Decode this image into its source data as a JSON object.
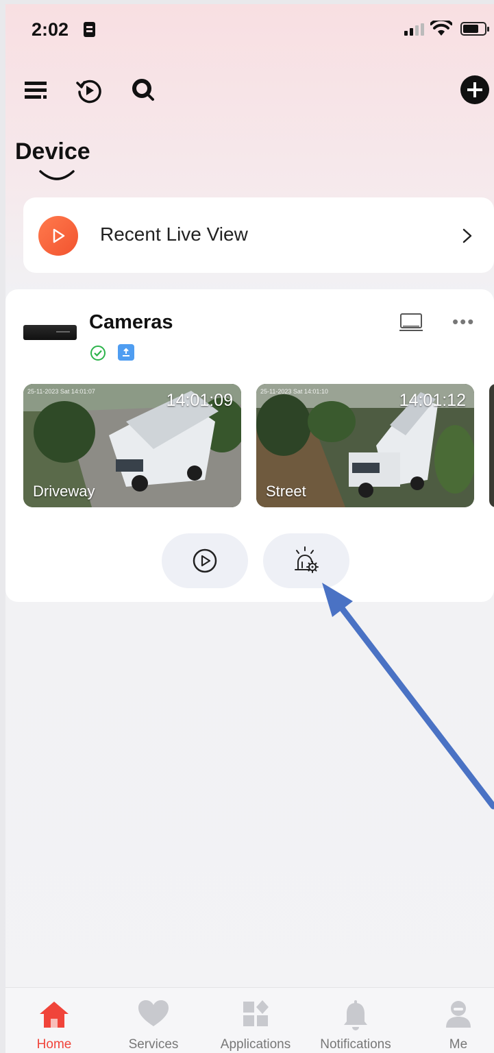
{
  "status_bar": {
    "time": "2:02"
  },
  "header": {
    "title": "Device"
  },
  "recent_live_view": {
    "label": "Recent Live View"
  },
  "cameras_card": {
    "title": "Cameras",
    "more": "•••",
    "cameras": [
      {
        "name": "Driveway",
        "clock": "14:01:09",
        "stamp": "25-11-2023 Sat 14:01:07"
      },
      {
        "name": "Street",
        "clock": "14:01:12",
        "stamp": "25-11-2023 Sat 14:01:10"
      }
    ]
  },
  "tabbar": {
    "tabs": [
      {
        "label": "Home",
        "icon": "home-icon",
        "active": true
      },
      {
        "label": "Services",
        "icon": "heart-icon"
      },
      {
        "label": "Applications",
        "icon": "apps-icon"
      },
      {
        "label": "Notifications",
        "icon": "bell-icon"
      },
      {
        "label": "Me",
        "icon": "person-icon"
      }
    ]
  },
  "colors": {
    "accent": "#f0443a",
    "online": "#2bb34a",
    "storage": "#4f9df1",
    "annotation_arrow": "#4a72c4"
  }
}
